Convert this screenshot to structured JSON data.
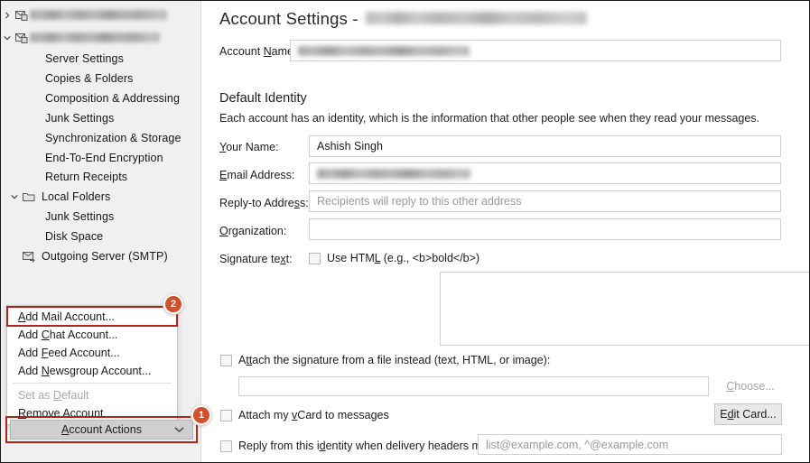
{
  "window": {
    "title_prefix": "Account Settings -",
    "title_value_redacted": true
  },
  "sidebar": {
    "accounts": [
      {
        "label": "",
        "redacted": true,
        "blur_width": 152,
        "icon": "mail-account-icon",
        "expanded": false
      },
      {
        "label": "",
        "redacted": true,
        "blur_width": 144,
        "icon": "mail-account-icon",
        "expanded": true
      }
    ],
    "account_children": [
      "Server Settings",
      "Copies & Folders",
      "Composition & Addressing",
      "Junk Settings",
      "Synchronization & Storage",
      "End-To-End Encryption",
      "Return Receipts"
    ],
    "local_folders": {
      "label": "Local Folders",
      "icon": "folder-icon",
      "expanded": true,
      "children": [
        "Junk Settings",
        "Disk Space"
      ]
    },
    "outgoing_server": {
      "label": "Outgoing Server (SMTP)",
      "icon": "outgoing-server-icon"
    }
  },
  "menu": {
    "items": [
      {
        "label": "Add Mail Account...",
        "accel": "A",
        "disabled": false,
        "highlighted": true
      },
      {
        "label": "Add Chat Account...",
        "accel": "C",
        "disabled": false,
        "highlighted": false
      },
      {
        "label": "Add Feed Account...",
        "accel": "F",
        "disabled": false,
        "highlighted": false
      },
      {
        "label": "Add Newsgroup Account...",
        "accel": "N",
        "disabled": false,
        "highlighted": false
      },
      {
        "label": "Set as Default",
        "accel": "D",
        "disabled": true,
        "highlighted": false
      },
      {
        "label": "Remove Account",
        "accel": "R",
        "disabled": false,
        "highlighted": false
      }
    ],
    "separator_after_index": 3
  },
  "account_actions_button": {
    "label": "Account Actions",
    "accel": "A",
    "icon": "chevron-down-icon"
  },
  "annotations": {
    "badge_1": "1",
    "badge_2": "2",
    "highlight_color": "#b42318",
    "badge_color": "#d2502c"
  },
  "main": {
    "account_name": {
      "label": "Account Name:",
      "accel": "N",
      "value": "",
      "redacted": true,
      "blur_width": 190
    },
    "default_identity": {
      "heading": "Default Identity",
      "description": "Each account has an identity, which is the information that other people see when they read your messages."
    },
    "fields": {
      "your_name": {
        "label": "Your Name:",
        "value": "Ashish Singh",
        "placeholder": ""
      },
      "email_address": {
        "label": "Email Address:",
        "value": "",
        "redacted": true,
        "blur_width": 170,
        "placeholder": ""
      },
      "reply_to": {
        "label": "Reply-to Address:",
        "value": "",
        "placeholder": "Recipients will reply to this other address"
      },
      "organization": {
        "label": "Organization:",
        "value": "",
        "placeholder": ""
      }
    },
    "signature": {
      "label": "Signature text:",
      "use_html_checkbox": {
        "label": "Use HTML (e.g., <b>bold</b>)",
        "checked": false
      },
      "textarea_value": ""
    },
    "attach_signature_file": {
      "label": "Attach the signature from a file instead (text, HTML, or image):",
      "checked": false,
      "file_path": "",
      "choose_button": {
        "label": "Choose...",
        "accel": "C",
        "disabled": true
      }
    },
    "attach_vcard": {
      "label": "Attach my vCard to messages",
      "checked": false,
      "edit_card_button": {
        "label": "Edit Card...",
        "accel": "d",
        "disabled": false
      }
    },
    "reply_from_identity": {
      "label": "Reply from this identity when delivery headers match:",
      "checked": false,
      "value": "",
      "placeholder": "list@example.com, ^@example.com"
    }
  }
}
